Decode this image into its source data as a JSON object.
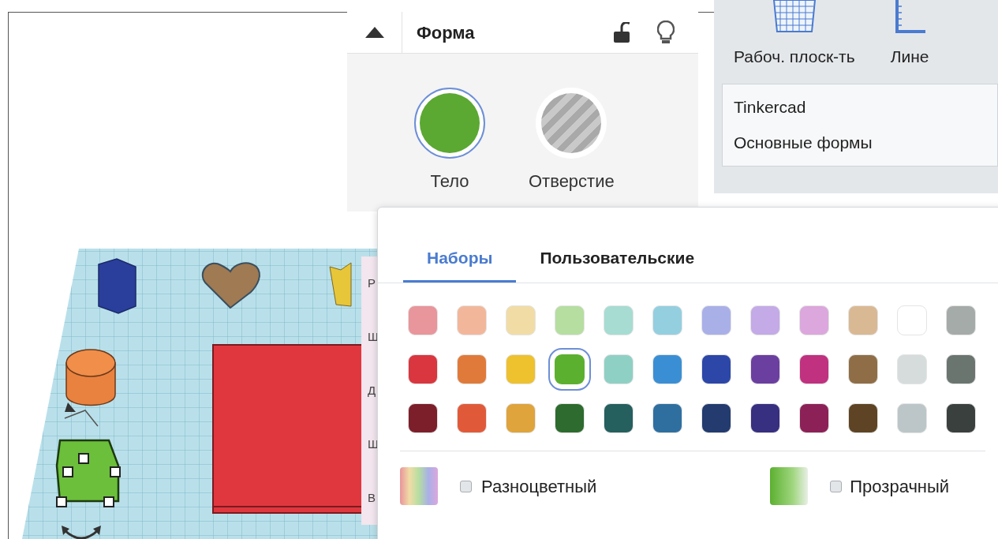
{
  "shape_panel": {
    "title": "Форма",
    "modes": [
      {
        "label": "Тело",
        "kind": "solid",
        "selected": true
      },
      {
        "label": "Отверстие",
        "kind": "hole",
        "selected": false
      }
    ]
  },
  "library": {
    "tools": [
      {
        "label": "Рабоч. плоск-ть",
        "kind": "workplane"
      },
      {
        "label": "Лине",
        "kind": "ruler"
      }
    ],
    "dropdown": [
      "Tinkercad",
      "Основные формы"
    ]
  },
  "properties_labels": [
    "Р",
    "Ш",
    "Д",
    "Ш",
    "В"
  ],
  "color_popup": {
    "tabs": [
      {
        "label": "Наборы",
        "selected": true
      },
      {
        "label": "Пользовательские",
        "selected": false
      }
    ],
    "swatches": [
      [
        {
          "color": "#e8959b",
          "selected": false
        },
        {
          "color": "#f2b79a",
          "selected": false
        },
        {
          "color": "#f1dca6",
          "selected": false
        },
        {
          "color": "#b5dea0",
          "selected": false
        },
        {
          "color": "#a6dcd2",
          "selected": false
        },
        {
          "color": "#94cfe0",
          "selected": false
        },
        {
          "color": "#a9b0e8",
          "selected": false
        },
        {
          "color": "#c4aae6",
          "selected": false
        },
        {
          "color": "#dba7dc",
          "selected": false
        },
        {
          "color": "#d9b994",
          "selected": false
        },
        {
          "color": "#ffffff",
          "selected": false
        },
        {
          "color": "#a5aba8",
          "selected": false
        }
      ],
      [
        {
          "color": "#d9363f",
          "selected": false
        },
        {
          "color": "#e07a3a",
          "selected": false
        },
        {
          "color": "#eec12e",
          "selected": false
        },
        {
          "color": "#5cb030",
          "selected": true
        },
        {
          "color": "#8fd0c4",
          "selected": false
        },
        {
          "color": "#3a8fd4",
          "selected": false
        },
        {
          "color": "#2c47a7",
          "selected": false
        },
        {
          "color": "#6b3fa0",
          "selected": false
        },
        {
          "color": "#c0317f",
          "selected": false
        },
        {
          "color": "#8f6e47",
          "selected": false
        },
        {
          "color": "#d6dcdc",
          "selected": false
        },
        {
          "color": "#6b7570",
          "selected": false
        }
      ],
      [
        {
          "color": "#7c1f2a",
          "selected": false
        },
        {
          "color": "#e05a3a",
          "selected": false
        },
        {
          "color": "#dfa43c",
          "selected": false
        },
        {
          "color": "#2d6b2e",
          "selected": false
        },
        {
          "color": "#255f5e",
          "selected": false
        },
        {
          "color": "#2f6fa0",
          "selected": false
        },
        {
          "color": "#233b6e",
          "selected": false
        },
        {
          "color": "#372f80",
          "selected": false
        },
        {
          "color": "#8c2157",
          "selected": false
        },
        {
          "color": "#5e4424",
          "selected": false
        },
        {
          "color": "#bcc6c8",
          "selected": false
        },
        {
          "color": "#3a403e",
          "selected": false
        }
      ]
    ],
    "multicolor": {
      "label": "Разноцветный",
      "checked": false
    },
    "transparent": {
      "label": "Прозрачный",
      "checked": false
    }
  }
}
